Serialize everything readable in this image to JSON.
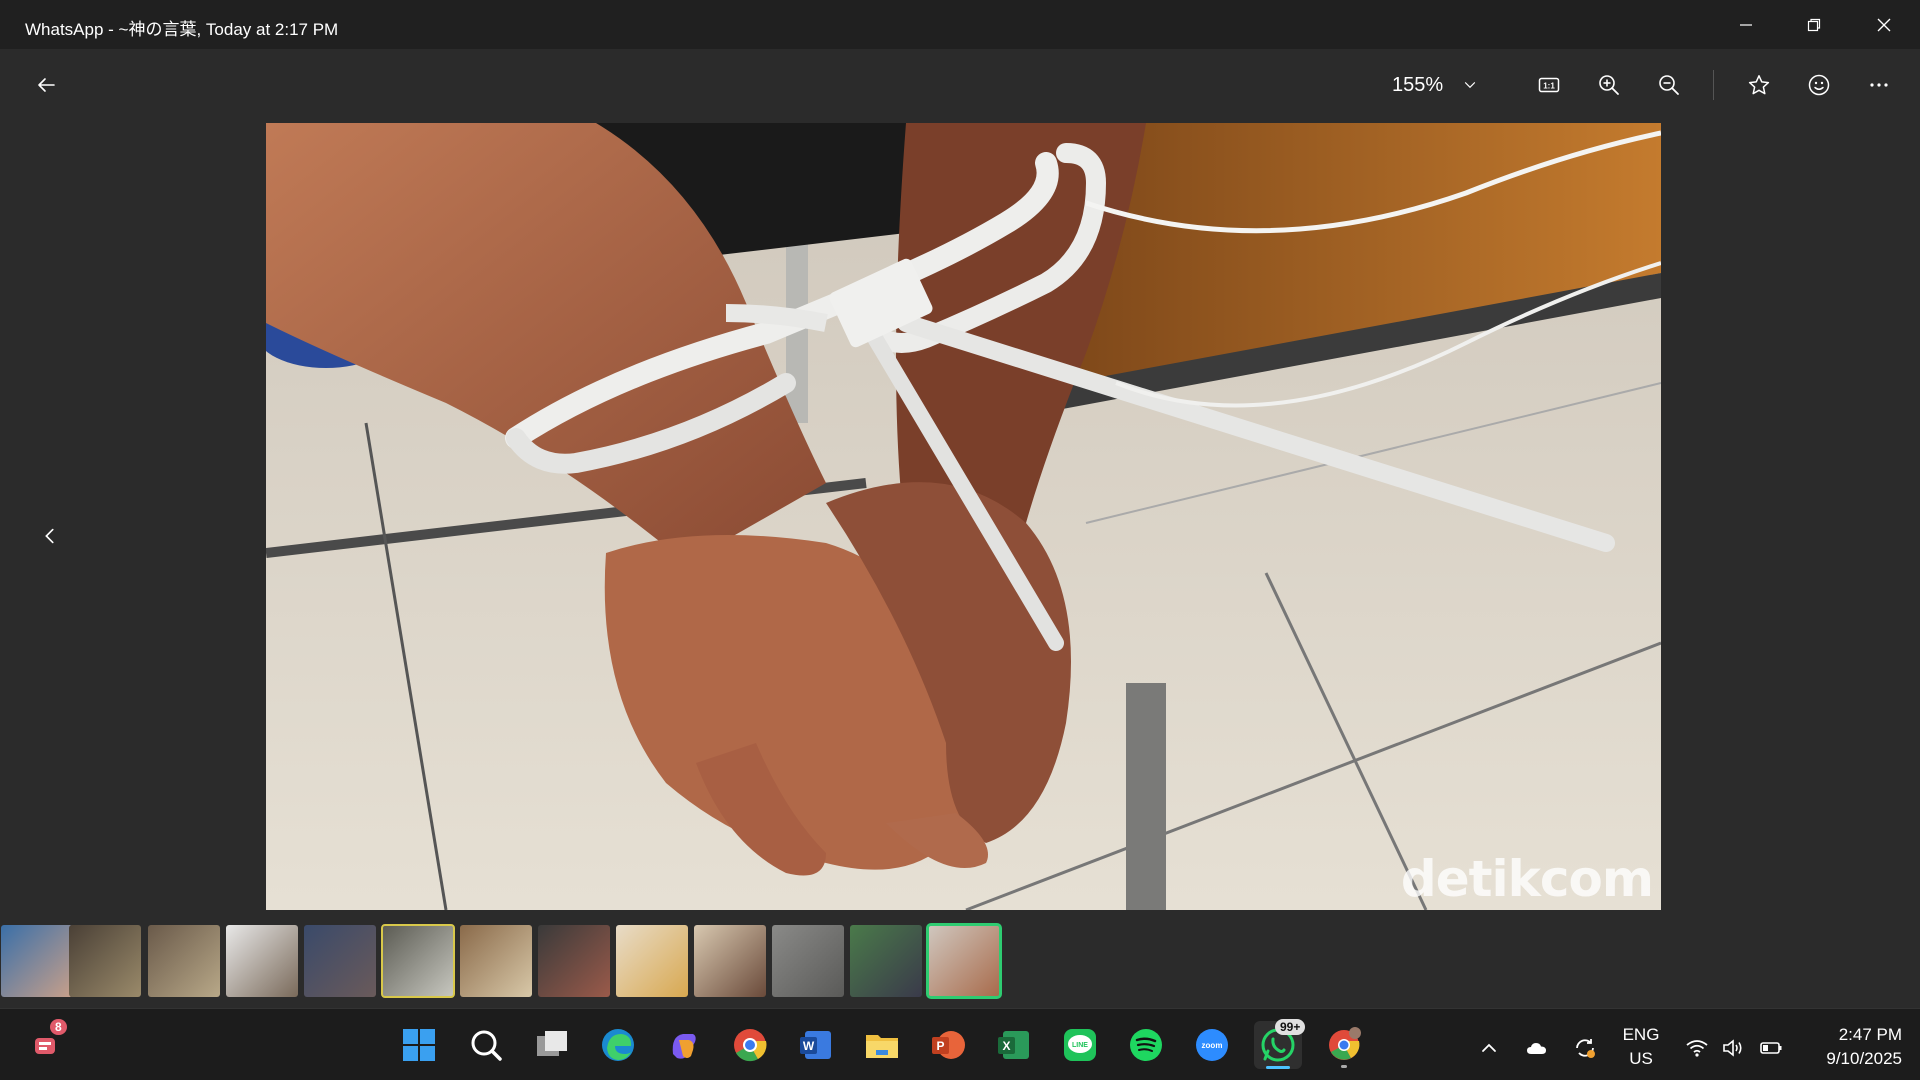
{
  "window": {
    "title": "WhatsApp - ~神の言葉, Today at 2:17 PM"
  },
  "toolbar": {
    "zoom_level": "155%",
    "icons": [
      "back-arrow-icon",
      "chevron-down-icon",
      "actual-size-icon",
      "zoom-in-icon",
      "zoom-out-icon",
      "star-icon",
      "smiley-icon",
      "more-icon"
    ]
  },
  "image": {
    "watermark": "detikcom"
  },
  "filmstrip": {
    "count": 13,
    "selected_index": 12,
    "marked_index": 5
  },
  "taskbar": {
    "notification_badge": "8",
    "whatsapp_badge": "99+",
    "language_line1": "ENG",
    "language_line2": "US",
    "time": "2:47 PM",
    "date": "9/10/2025"
  },
  "colors": {
    "accent": "#4cc2ff",
    "selection": "#2ecc71",
    "background": "#2b2b2b",
    "titlebar": "#202020"
  }
}
